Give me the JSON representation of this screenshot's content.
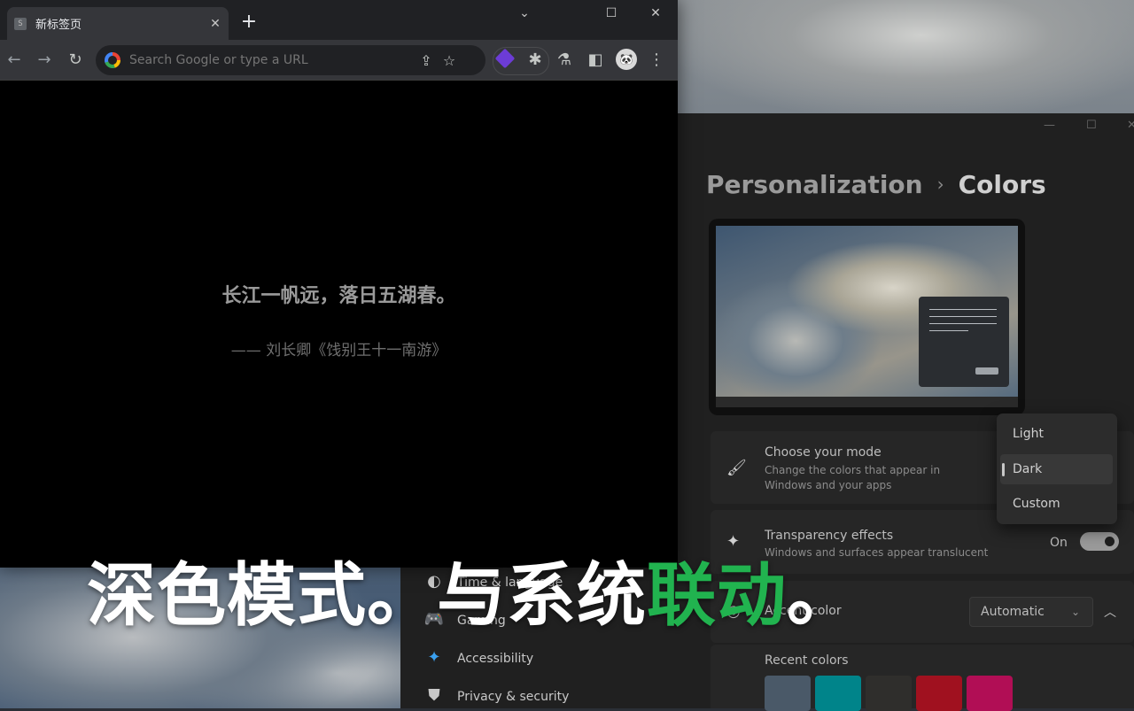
{
  "chrome": {
    "tab_title": "新标签页",
    "tab_favicon": "S",
    "omnibox_placeholder": "Search Google or type a URL",
    "quote": "长江一帆远，落日五湖春。",
    "quote_source": "—— 刘长卿《饯别王十一南游》",
    "avatar": "🐼"
  },
  "settings": {
    "breadcrumb_parent": "Personalization",
    "breadcrumb_current": "Colors",
    "mode": {
      "title": "Choose your mode",
      "desc_line1": "Change the colors that appear in",
      "desc_line2": "Windows and your apps",
      "options": [
        "Light",
        "Dark",
        "Custom"
      ],
      "selected": "Dark"
    },
    "transparency": {
      "title": "Transparency effects",
      "desc": "Windows and surfaces appear translucent",
      "value": "On"
    },
    "accent": {
      "title": "Accent color",
      "value": "Automatic"
    },
    "recent_colors_label": "Recent colors",
    "recent_colors": [
      "#4a5968",
      "#00848a",
      "#2f2e2c",
      "#a0111f",
      "#b10e55"
    ],
    "nav": [
      {
        "label": "Time & language",
        "icon": "globe-icon"
      },
      {
        "label": "Gaming",
        "icon": "gamepad-icon"
      },
      {
        "label": "Accessibility",
        "icon": "accessibility-icon"
      },
      {
        "label": "Privacy & security",
        "icon": "shield-icon"
      }
    ]
  },
  "caption": {
    "part1": "深色模式。与系统",
    "highlight": "联动",
    "part2": "。",
    "highlight_color": "#21b34f"
  }
}
